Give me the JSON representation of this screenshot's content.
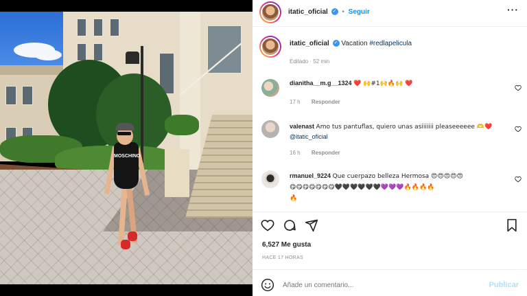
{
  "post": {
    "photo_text": "MOSCHINO"
  },
  "header": {
    "username": "itatic_oficial",
    "separator": "•",
    "follow_label": "Seguir",
    "more_icon": "more-horizontal-icon"
  },
  "caption": {
    "username": "itatic_oficial",
    "text": "Vacation",
    "hashtag": "#redlapelicula",
    "meta": "Editado · 52 min"
  },
  "comments": [
    {
      "username": "dianitha__m.g__1324",
      "text": "❤️ 🙌#1🙌🔥🙌 ❤️",
      "time": "17 h",
      "reply_label": "Responder"
    },
    {
      "username": "valenast",
      "text": "Amo tus pantuflas, quiero unas asiiiiiii pleaseeeeee 🫶❤️",
      "mention": "@itatic_oficial",
      "time": "16 h",
      "reply_label": "Responder"
    },
    {
      "username": "rmanuel_9224",
      "text": "Que cuerpazo belleza Hermosa 😍😍😍😍😍",
      "text2": "😋😋😋😋😋😋😋🖤🖤🖤🖤🖤🖤💜💜💜🔥🔥🔥🔥",
      "text3": "🔥"
    }
  ],
  "actions": {
    "like_icon": "heart-icon",
    "comment_icon": "comment-icon",
    "share_icon": "share-icon",
    "save_icon": "bookmark-icon"
  },
  "likes": "6,527 Me gusta",
  "posted": "HACE 17 HORAS",
  "composer": {
    "emoji_icon": "smiley-icon",
    "placeholder": "Añade un comentario...",
    "post_label": "Publicar"
  },
  "colors": {
    "accent": "#0095f6",
    "verified": "#3897f0",
    "muted": "#8e8e8e",
    "heart": "#ed4956"
  }
}
